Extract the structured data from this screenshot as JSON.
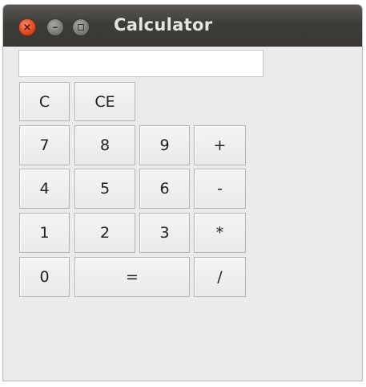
{
  "window": {
    "title": "Calculator",
    "controls": {
      "close_icon": "close-icon",
      "minimize_icon": "minimize-icon",
      "maximize_icon": "maximize-icon"
    }
  },
  "display": {
    "value": ""
  },
  "keys": {
    "clear": "C",
    "clear_entry": "CE",
    "seven": "7",
    "eight": "8",
    "nine": "9",
    "plus": "+",
    "four": "4",
    "five": "5",
    "six": "6",
    "minus": "-",
    "one": "1",
    "two": "2",
    "three": "3",
    "multiply": "*",
    "zero": "0",
    "equals": "=",
    "divide": "/"
  },
  "colors": {
    "titlebar": "#3e3d39",
    "window_bg": "#ebebeb",
    "close_button": "#e2461d"
  }
}
